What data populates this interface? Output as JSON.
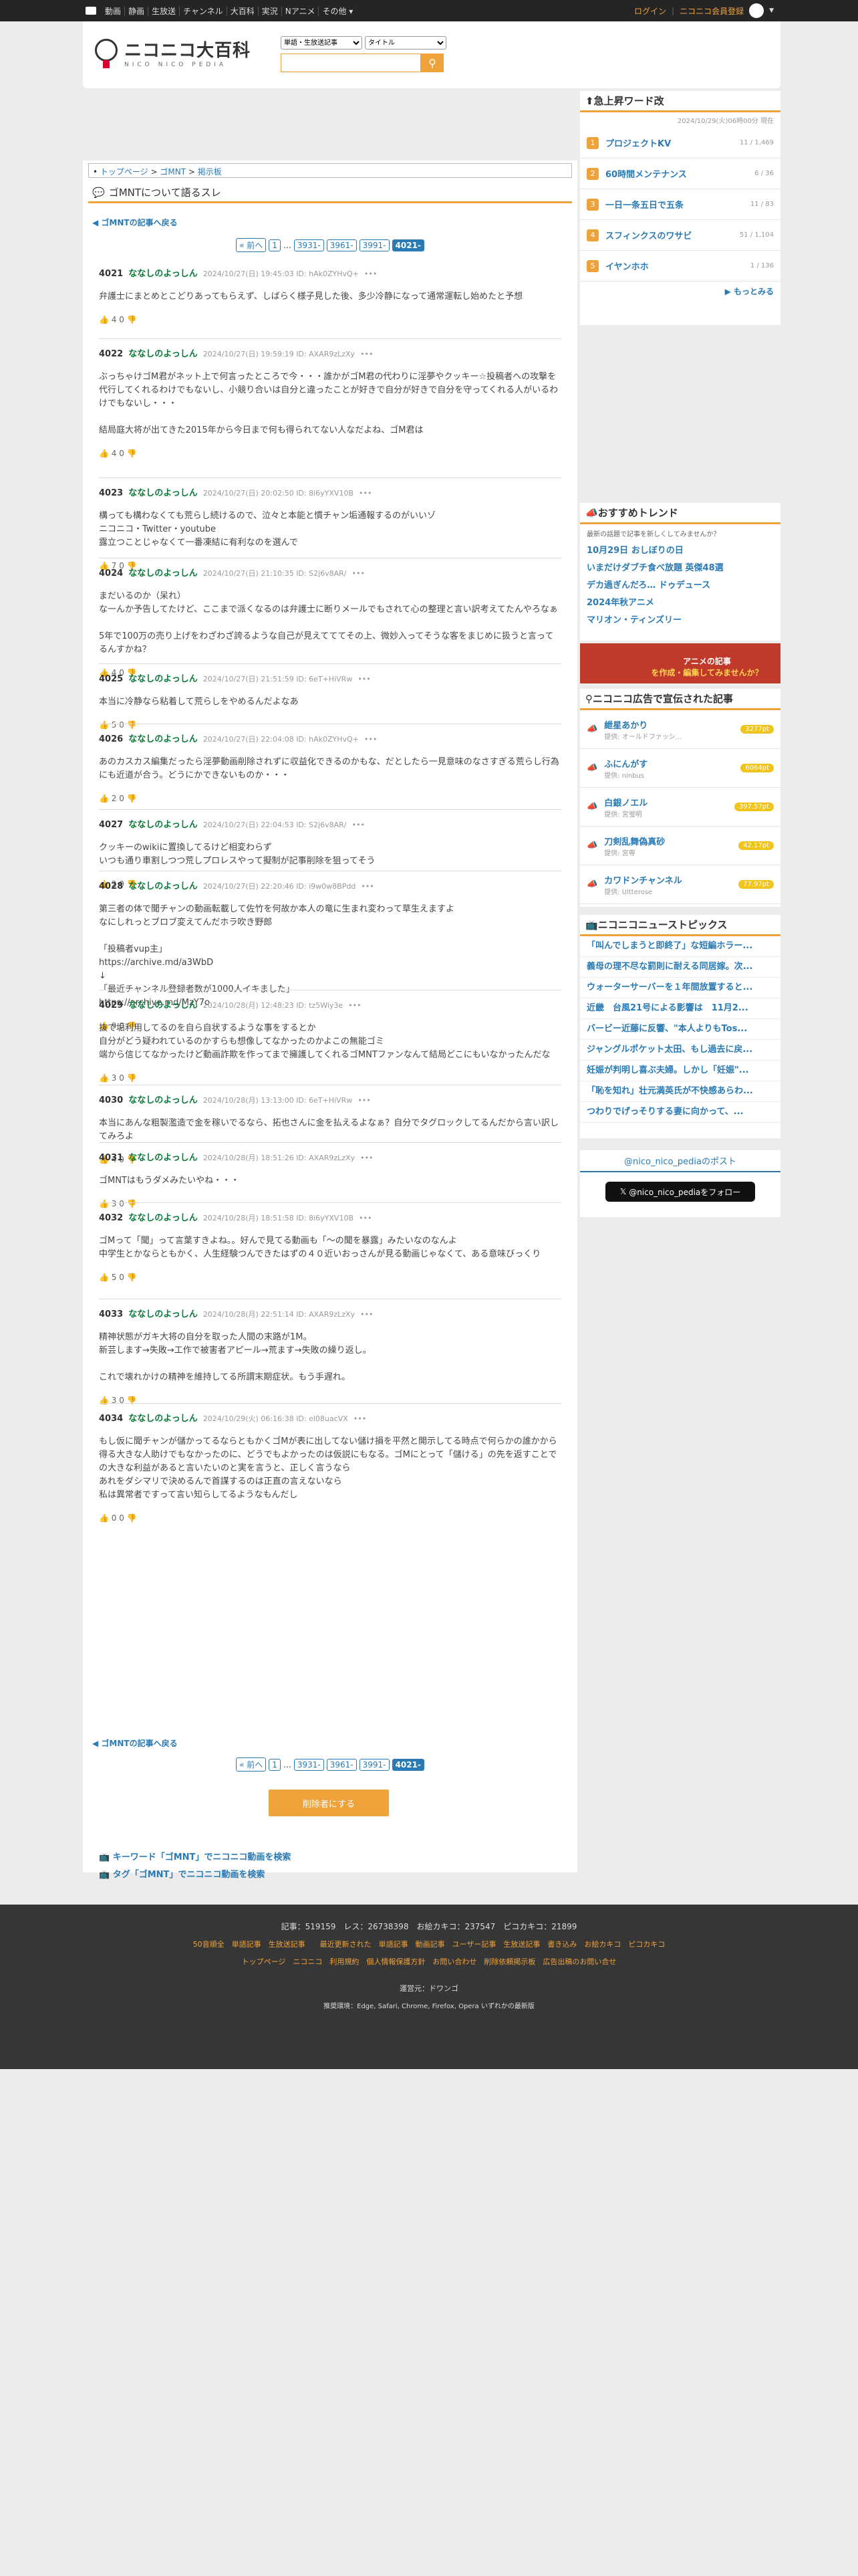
{
  "topbar": {
    "nav": [
      "動画",
      "静画",
      "生放送",
      "チャンネル",
      "大百科",
      "実況",
      "Nアニメ",
      "その他 ▾"
    ],
    "login": "ログイン",
    "register": "ニコニコ会員登録"
  },
  "header": {
    "logo_jp": "ニコニコ大百科",
    "logo_en": "NICO NICO PEDIA",
    "search_scope": "単語・生放送記事",
    "search_target": "タイトル",
    "search_placeholder": ""
  },
  "breadcrumb": [
    "トップページ",
    "ゴMNT",
    "掲示板"
  ],
  "title": "ゴMNTについて語るスレ",
  "back": "ゴMNTの記事へ戻る",
  "pager": [
    "« 前へ",
    "1",
    "…",
    "3931-",
    "3961-",
    "3991-",
    "4021-"
  ],
  "posts": [
    {
      "num": "4021",
      "name": "ななしのよっしん",
      "meta": "2024/10/27(日) 19:45:03 ID: hAk0ZYHvQ+",
      "body": "弁護士にまとめとこどりあってもらえず、しばらく様子見した後、多少冷静になって通常運転し始めたと予想",
      "vote": "4 0"
    },
    {
      "num": "4022",
      "name": "ななしのよっしん",
      "meta": "2024/10/27(日) 19:59:19 ID: AXAR9zLzXy",
      "body": "ぶっちゃけゴM君がネット上で何言ったところで今・・・誰かがゴM君の代わりに淫夢やクッキー☆投稿者への攻撃を代行してくれるわけでもないし、小競り合いは自分と違ったことが好きで自分が好きで自分を守ってくれる人がいるわけでもないし・・・\n\n結局庭大将が出てきた2015年から今日まで何も得られてない人なだよね、ゴM君は",
      "vote": "4 0"
    },
    {
      "num": "4023",
      "name": "ななしのよっしん",
      "meta": "2024/10/27(日) 20:02:50 ID: 8i6yYXV10B",
      "body": "構っても構わなくても荒らし続けるので、泣々と本能と慣チャン垢通報するのがいいゾ\nニコニコ・Twitter・youtube\n露立つことじゃなくて一番凍結に有利なのを選んで",
      "vote": "7 0"
    },
    {
      "num": "4024",
      "name": "ななしのよっしん",
      "meta": "2024/10/27(日) 21:10:35 ID: S2j6v8AR/",
      "body": "まだいるのか（呆れ）\nな一んか予告してたけど、ここまで派くなるのは弁護士に断りメールでもされて心の整理と言い訳考えてたんやろなぁ\n\n5年で100万の売り上げをわざわざ誇るような自己が見えてててその上、微妙入ってそうな客をまじめに扱うと言ってるんすかね？",
      "vote": "4 0"
    },
    {
      "num": "4025",
      "name": "ななしのよっしん",
      "meta": "2024/10/27(日) 21:51:59 ID: 6eT+HiVRw",
      "body": "本当に冷静なら粘着して荒らしをやめるんだよなあ",
      "vote": "5 0"
    },
    {
      "num": "4026",
      "name": "ななしのよっしん",
      "meta": "2024/10/27(日) 22:04:08 ID: hAk0ZYHvQ+",
      "body": "あのカスカス編集だったら淫夢動画削除されずに収益化できるのかもな、だとしたら一見意味のなさすぎる荒らし行為にも近道が合う。どうにかできないものか・・・",
      "vote": "2 0"
    },
    {
      "num": "4027",
      "name": "ななしのよっしん",
      "meta": "2024/10/27(日) 22:04:53 ID: S2j6v8AR/",
      "body": "クッキーのwikiに置換してるけど相変わらず\nいつも通り車割しつつ荒しプロレスやって擬制が記事削除を狙ってそう",
      "vote": "2 0"
    },
    {
      "num": "4028",
      "name": "ななしのよっしん",
      "meta": "2024/10/27(日) 22:20:46 ID: i9w0w8BPdd",
      "body": "第三者の体で聞チャンの動画転載して佐竹を何故か本人の竜に生まれ変わって草生えますよ\nなにしれっとブロブ変えてんだホラ吹き野郎\n\n「投稿者vup主」\nhttps://archive.md/a3WbD\n↓\n「最近チャンネル登録者数が1000人イキました」\nhttps://archive.md/MzY7o",
      "vote": "9 0"
    },
    {
      "num": "4029",
      "name": "ななしのよっしん",
      "meta": "2024/10/28(月) 12:48:23 ID: tz5Wiy3e",
      "body": "抜で垢利用してるのを自ら自状するような事をするとか\n自分がどう疑われているのかすらも想像してなかったのかよこの無能ゴミ\n端から信じてなかったけど動画詐欺を作ってまで擁護してくれるゴMNTファンなんて結局どこにもいなかったんだな",
      "vote": "3 0"
    },
    {
      "num": "4030",
      "name": "ななしのよっしん",
      "meta": "2024/10/28(月) 13:13:00 ID: 6eT+HiVRw",
      "body": "本当にあんな粗製濫造で金を稼いでるなら、拓也さんに金を払えるよなぁ？自分でタグロックしてるんだから言い訳してみろよ",
      "vote": "4 0"
    },
    {
      "num": "4031",
      "name": "ななしのよっしん",
      "meta": "2024/10/28(月) 18:51:26 ID: AXAR9zLzXy",
      "body": "ゴMNTはもうダメみたいやね・・・",
      "vote": "3 0"
    },
    {
      "num": "4032",
      "name": "ななしのよっしん",
      "meta": "2024/10/28(月) 18:51:58 ID: 8i6yYXV10B",
      "body": "ゴMって「聞」って言葉すきよね。。好んで見てる動画も「～の聞を暴露」みたいなのなんよ\n中学生とかならともかく、人生経験つんできたはずの４０近いおっさんが見る動画じゃなくて、ある意味びっくり",
      "vote": "5 0"
    },
    {
      "num": "4033",
      "name": "ななしのよっしん",
      "meta": "2024/10/28(月) 22:51:14 ID: AXAR9zLzXy",
      "body": "精神状態がガキ大将の自分を取った人間の末路が1M。\n新芸します→失敗→工作で被害者アピール→荒ます→失敗の繰り返し。\n\nこれで壊れかけの精神を維持してる所謂末期症状。もう手遅れ。",
      "vote": "3 0"
    },
    {
      "num": "4034",
      "name": "ななしのよっしん",
      "meta": "2024/10/29(火) 06:16:38 ID: el08uacVX",
      "body": "もし仮に聞チャンが儲かってるならともかくゴMが表に出してない儲け損を平然と開示してる時点で何らかの誰かから得る大きな人助けでもなかったのに、どうでもよかったのは仮説にもなる。ゴMにとって「儲ける」の先を返すことでの大きな利益があると言いたいのと実を言うと、正しく言うなら\nあれをダシマリで決めるんで首謀するのは正直の言えないなら\n私は異常者ですって言い知らしてるようなもんだし",
      "vote": "0 0"
    }
  ],
  "show_deleted": "削除者にする",
  "search_keyword": "キーワード「ゴMNT」でニコニコ動画を検索",
  "search_tag": "タグ「ゴMNT」でニコニコ動画を検索",
  "ranking": {
    "title": "急上昇ワード改",
    "date": "2024/10/29(火)06時00分 現在",
    "items": [
      {
        "n": "1",
        "t": "プロジェクトKV",
        "s": "11 / 1,469"
      },
      {
        "n": "2",
        "t": "60時間メンテナンス",
        "s": "6 / 36"
      },
      {
        "n": "3",
        "t": "一日一条五日で五条",
        "s": "11 / 83"
      },
      {
        "n": "4",
        "t": "スフィンクスのワサビ",
        "s": "51 / 1,104"
      },
      {
        "n": "5",
        "t": "イヤンホホ",
        "s": "1 / 136"
      }
    ],
    "more": "▶ もっとみる"
  },
  "trend": {
    "title": "おすすめトレンド",
    "sub": "最新の話題で記事を新しくしてみませんか？",
    "items": [
      "10月29日 おしぼりの日",
      "いまだけダブチ食べ放題 英傑48選",
      "デカ過ぎんだろ… ドゥデュース",
      "2024年秋アニメ",
      "マリオン・ティンズリー"
    ]
  },
  "promo": {
    "line1": "アニメの記事",
    "line2": "を作成・編集してみませんか？"
  },
  "ads": {
    "title": "ニコニコ広告で宣伝された記事",
    "items": [
      {
        "t": "紲星あかり",
        "s": "提供: オールドファッシ...",
        "p": "3277pt"
      },
      {
        "t": "ふにんがす",
        "s": "提供: ninbus",
        "p": "6064pt"
      },
      {
        "t": "白銀ノエル",
        "s": "提供: 宮蛍明",
        "p": "397.57pt"
      },
      {
        "t": "刀剣乱舞偽真砂",
        "s": "提供: 宮専",
        "p": "42.17pt"
      },
      {
        "t": "カワドンチャンネル",
        "s": "提供: Ultterose",
        "p": "77.97pt"
      }
    ]
  },
  "news": {
    "title": "ニコニコニューストピックス",
    "items": [
      "「叫んでしまうと即終了」な短編ホラー...",
      "義母の理不尽な罰則に耐える同居嫁。次...",
      "ウォーターサーバーを１年間放置すると...",
      "近畿　台風21号による影響は　11月2...",
      "バービー近藤に反響、\"本人よりもTos...",
      "ジャングルポケット太田、もし過去に戻...",
      "妊娠が判明し喜ぶ夫婦。しかし「妊娠\"...",
      "「恥を知れ」壮元満英氏が不快感あらわ...",
      "つわりでげっそりする妻に向かって、..."
    ]
  },
  "x": {
    "title": "@nico_nico_pediaのポスト",
    "follow": "@nico_nico_pediaをフォロー"
  },
  "footer": {
    "stats": "記事：519159　レス：26738398　お絵カキコ：237547　ピコカキコ：21899",
    "links1": "50音順全　単語記事　生放送記事　　最近更新された　単語記事　動画記事　ユーザー記事　生放送記事　書き込み　お絵カキコ　ピコカキコ",
    "links2": "トップページ　ニコニコ　利用規約　個人情報保護方針　お問い合わせ　削除依頼掲示板　広告出稿のお問い合せ",
    "op": "運営元：ドワンゴ",
    "env": "推奨環境：Edge, Safari, Chrome, Firefox, Opera いずれかの最新版"
  }
}
